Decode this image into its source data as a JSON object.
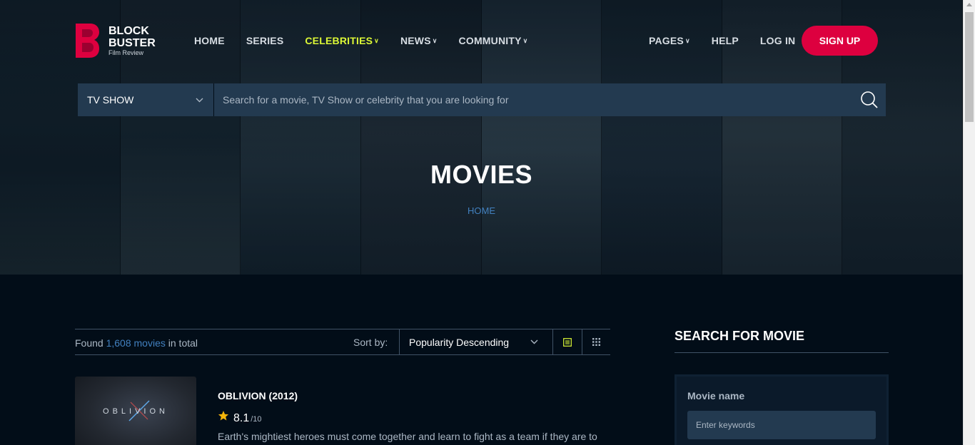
{
  "brand": {
    "line1": "BLOCK",
    "line2": "BUSTER",
    "tagline": "Film Review",
    "color": "#dd003f"
  },
  "nav": {
    "left": [
      {
        "label": "HOME",
        "dropdown": false,
        "active": false
      },
      {
        "label": "SERIES",
        "dropdown": false,
        "active": false
      },
      {
        "label": "CELEBRITIES",
        "dropdown": true,
        "active": true
      },
      {
        "label": "NEWS",
        "dropdown": true,
        "active": false
      },
      {
        "label": "COMMUNITY",
        "dropdown": true,
        "active": false
      }
    ],
    "right": [
      {
        "label": "PAGES",
        "dropdown": true
      },
      {
        "label": "HELP",
        "dropdown": false
      },
      {
        "label": "LOG IN",
        "dropdown": false
      }
    ],
    "signup_label": "SIGN UP",
    "active_color": "#dcf836"
  },
  "search": {
    "category": "TV SHOW",
    "placeholder": "Search for a movie, TV Show or celebrity that you are looking for",
    "icon": "search-icon"
  },
  "hero": {
    "title": "MOVIES",
    "breadcrumb": "HOME"
  },
  "listing": {
    "found_prefix": "Found",
    "found_count": "1,608 movies",
    "found_suffix": "in total",
    "sort_label": "Sort by:",
    "sort_value": "Popularity Descending",
    "view_list_icon": "list-view-icon",
    "view_grid_icon": "grid-view-icon"
  },
  "movies": [
    {
      "poster_text": "OBLIVION",
      "title": "OBLIVION (2012)",
      "rating": "8.1",
      "rating_max": "/10",
      "description": "Earth's mightiest heroes must come together and learn to fight as a team if they are to"
    }
  ],
  "sidebar": {
    "title": "SEARCH FOR MOVIE",
    "field_label": "Movie name",
    "field_placeholder": "Enter keywords"
  },
  "colors": {
    "background": "#020d18",
    "panel": "#233a50",
    "link": "#4280bf",
    "star": "#f5b50a"
  }
}
